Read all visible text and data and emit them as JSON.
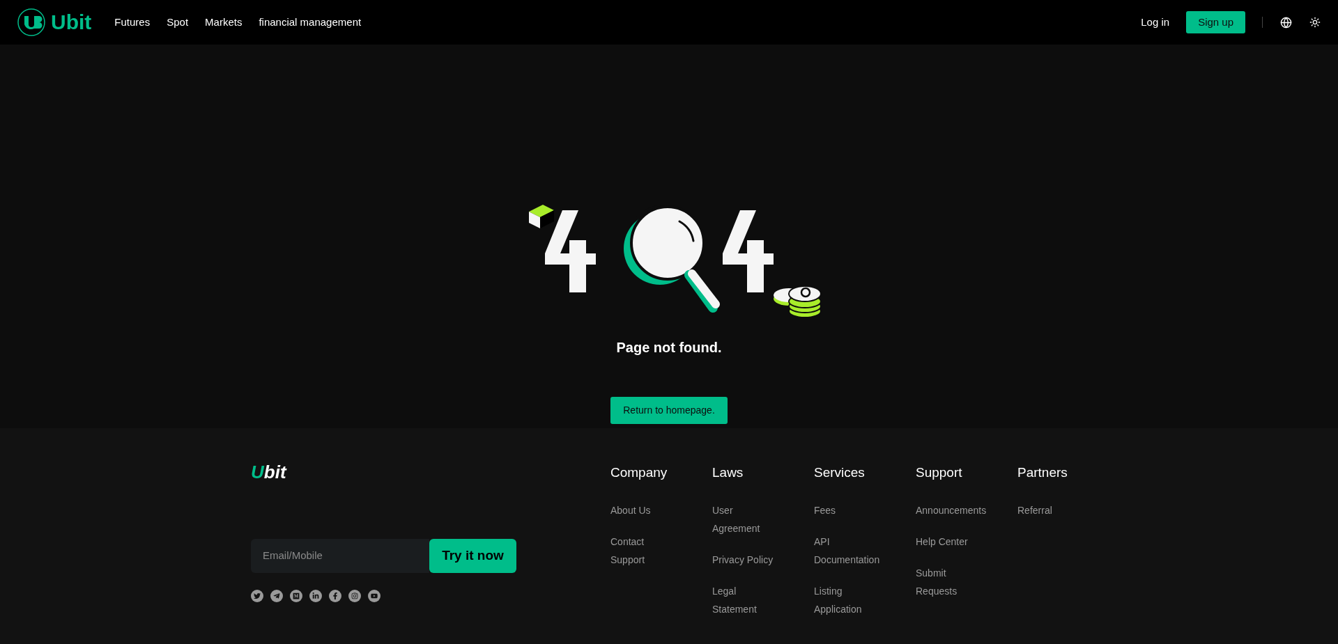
{
  "header": {
    "logo": "Ubit",
    "nav": [
      {
        "label": "Futures"
      },
      {
        "label": "Spot"
      },
      {
        "label": "Markets"
      },
      {
        "label": "financial management"
      }
    ],
    "login": "Log in",
    "signup": "Sign up"
  },
  "error": {
    "message": "Page not found.",
    "button": "Return to homepage."
  },
  "footer": {
    "logo": "Ubit",
    "email_placeholder": "Email/Mobile",
    "try_button": "Try it now",
    "socials": [
      {
        "kind": "twitter"
      },
      {
        "kind": "telegram"
      },
      {
        "kind": "medium"
      },
      {
        "kind": "linkedin"
      },
      {
        "kind": "facebook"
      },
      {
        "kind": "instagram"
      },
      {
        "kind": "youtube"
      }
    ],
    "columns": [
      {
        "title": "Company",
        "items": [
          [
            "About Us"
          ],
          [
            "Contact",
            "Support"
          ]
        ]
      },
      {
        "title": "Laws",
        "items": [
          [
            "User",
            "Agreement"
          ],
          [
            "Privacy Policy"
          ],
          [
            "Legal",
            "Statement"
          ]
        ]
      },
      {
        "title": "Services",
        "items": [
          [
            "Fees"
          ],
          [
            "API",
            "Documentation"
          ],
          [
            "Listing",
            "Application"
          ]
        ]
      },
      {
        "title": "Support",
        "items": [
          [
            "Announcements"
          ],
          [
            "Help Center"
          ],
          [
            "Submit",
            "Requests"
          ]
        ]
      },
      {
        "title": "Partners",
        "items": [
          [
            "Referral"
          ]
        ]
      }
    ]
  }
}
